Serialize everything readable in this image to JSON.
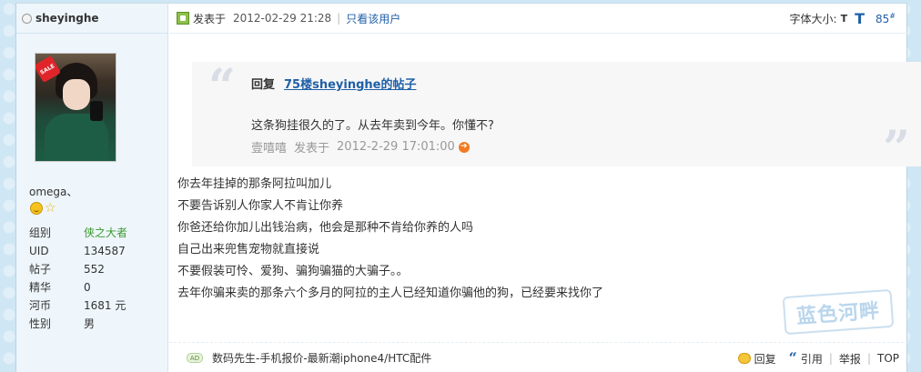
{
  "user": {
    "name": "sheyinghe",
    "rank_title": "omega、",
    "avatar_badge": "SALE",
    "info": [
      {
        "label": "组别",
        "value": "侠之大者"
      },
      {
        "label": "UID",
        "value": "134587"
      },
      {
        "label": "帖子",
        "value": "552"
      },
      {
        "label": "精华",
        "value": "0"
      },
      {
        "label": "河币",
        "value": "1681 元"
      },
      {
        "label": "性别",
        "value": "男"
      }
    ]
  },
  "post": {
    "posted_label": "发表于",
    "posted_at": "2012-02-29 21:28",
    "only_author": "只看该用户",
    "font_size_label": "字体大小:",
    "font_small": "T",
    "font_large": "T",
    "floor": "85",
    "floor_mark": "#"
  },
  "quote": {
    "reply_prefix": "回复",
    "reply_link": "75楼sheyinghe的帖子",
    "body": "这条狗挂很久的了。从去年卖到今年。你懂不?",
    "author": "壹嘻嘻",
    "posted_label": "发表于",
    "posted_at": "2012-2-29 17:01:00"
  },
  "message": [
    "你去年挂掉的那条阿拉叫加儿",
    "不要告诉别人你家人不肯让你养",
    "你爸还给你加儿出钱治病，他会是那种不肯给你养的人吗",
    "自己出来兜售宠物就直接说",
    "不要假装可怜、爱狗、骗狗骗猫的大骗子。。",
    "去年你骗来卖的那条六个多月的阿拉的主人已经知道你骗他的狗，已经要来找你了"
  ],
  "watermark": "蓝色河畔",
  "footer": {
    "ad_badge": "AD",
    "ad_text": "数码先生-手机报价-最新潮iphone4/HTC配件",
    "actions": {
      "reply": "回复",
      "quote": "引用",
      "report": "举报",
      "top": "TOP"
    }
  }
}
